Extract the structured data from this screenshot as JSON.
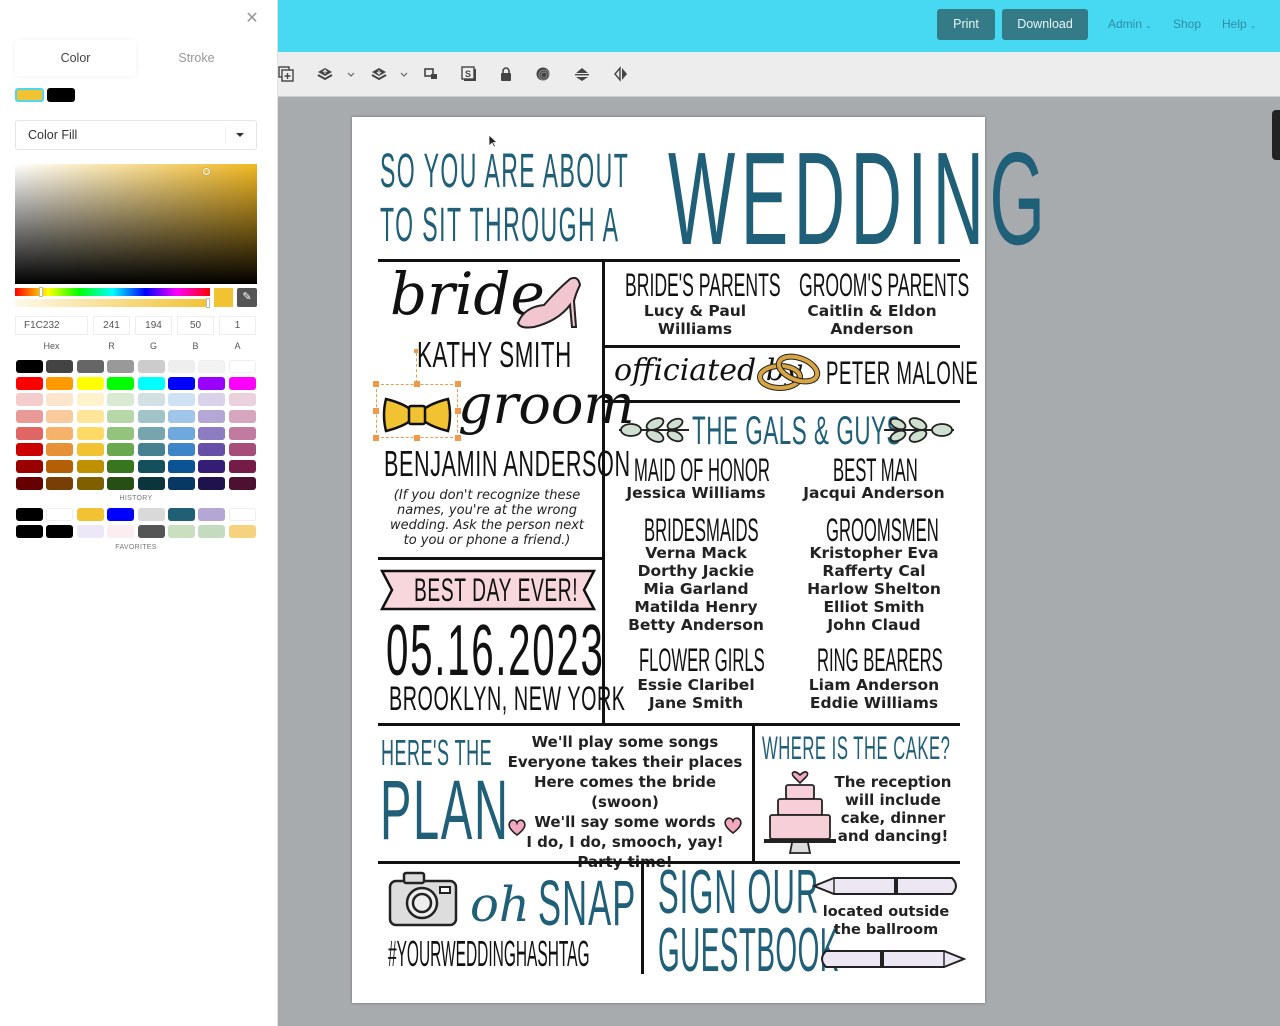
{
  "panel": {
    "close_icon": "close-icon",
    "tabs": [
      {
        "label": "Color",
        "active": true
      },
      {
        "label": "Stroke",
        "active": false
      }
    ],
    "selected_swatches": [
      "#F1C232",
      "#000000"
    ],
    "fill_mode": "Color Fill",
    "picker": {
      "hex": "F1C232",
      "r": "241",
      "g": "194",
      "b": "50",
      "a": "1",
      "labels": {
        "hex": "Hex",
        "r": "R",
        "g": "G",
        "b": "B",
        "a": "A"
      }
    },
    "palette": [
      "#000000",
      "#434343",
      "#666666",
      "#999999",
      "#cccccc",
      "#eeeeee",
      "#f3f3f3",
      "#ffffff",
      "#ff0000",
      "#ff9900",
      "#ffff00",
      "#00ff00",
      "#00ffff",
      "#0000ff",
      "#9900ff",
      "#ff00ff",
      "#f4cccc",
      "#fce5cd",
      "#fff2cc",
      "#d9ead3",
      "#d0e0e3",
      "#cfe2f3",
      "#d9d2e9",
      "#ead1dc",
      "#ea9999",
      "#f9cb9c",
      "#ffe599",
      "#b6d7a8",
      "#a2c4c9",
      "#9fc5e8",
      "#b4a7d6",
      "#d5a6bd",
      "#e06666",
      "#f6b26b",
      "#ffd966",
      "#93c47d",
      "#76a5af",
      "#6fa8dc",
      "#8e7cc3",
      "#c27ba0",
      "#cc0000",
      "#e69138",
      "#f1c232",
      "#6aa84f",
      "#45818e",
      "#3d85c6",
      "#674ea7",
      "#a64d79",
      "#990000",
      "#b45f06",
      "#bf9000",
      "#38761d",
      "#134f5c",
      "#0b5394",
      "#351c75",
      "#741b47",
      "#660000",
      "#783f04",
      "#7f6000",
      "#274e13",
      "#0c343d",
      "#073763",
      "#20124d",
      "#4c1130"
    ],
    "history_label": "HISTORY",
    "history": [
      "#000000",
      "#ffffff",
      "#f1c232",
      "#0000ff",
      "#d9d9d9",
      "#1f6077",
      "#b4a7d6",
      "#ffffff",
      "#000000",
      "#000000",
      "#ece8f8",
      "#fbeef0",
      "#555555",
      "#c9dfc0",
      "#c5dbbf",
      "#f5d27e"
    ],
    "favorites_label": "FAVORITES"
  },
  "topbar": {
    "print": "Print",
    "download": "Download",
    "nav": [
      {
        "label": "Admin",
        "dropdown": true
      },
      {
        "label": "Shop",
        "dropdown": false
      },
      {
        "label": "Help",
        "dropdown": true
      }
    ]
  },
  "toolbar": {
    "icons": [
      "duplicate-icon",
      "layer-up-icon",
      "layer-down-icon",
      "resize-icon",
      "s-badge-icon",
      "lock-icon",
      "opacity-icon",
      "align-icon",
      "flip-icon"
    ]
  },
  "poster": {
    "title_small_1": "SO YOU ARE ABOUT",
    "title_small_2": "TO SIT THROUGH A",
    "title_big": "WEDDING",
    "bride_script": "bride",
    "bride_name": "KATHY SMITH",
    "groom_script": "groom",
    "groom_name": "BENJAMIN ANDERSON",
    "disclaimer": "(If you don't recognize these names, you're at the wrong wedding. Ask the person next to you or phone a friend.)",
    "brides_parents_title": "BRIDE'S PARENTS",
    "brides_parents": [
      "Lucy & Paul",
      "Williams"
    ],
    "grooms_parents_title": "GROOM'S PARENTS",
    "grooms_parents": [
      "Caitlin & Eldon",
      "Anderson"
    ],
    "officiated_script": "officiated by",
    "officiant": "PETER MALONE",
    "party_title": "THE GALS & GUYS",
    "maid_title": "MAID OF HONOR",
    "maid": "Jessica Williams",
    "bestman_title": "BEST MAN",
    "bestman": "Jacqui Anderson",
    "bridesmaids_title": "BRIDESMAIDS",
    "bridesmaids": [
      "Verna Mack",
      "Dorthy Jackie",
      "Mia Garland",
      "Matilda Henry",
      "Betty Anderson"
    ],
    "groomsmen_title": "GROOMSMEN",
    "groomsmen": [
      "Kristopher Eva",
      "Rafferty Cal",
      "Harlow Shelton",
      "Elliot Smith",
      "John Claud"
    ],
    "flowergirls_title": "FLOWER GIRLS",
    "flowergirls": [
      "Essie Claribel",
      "Jane Smith"
    ],
    "ringbearers_title": "RING BEARERS",
    "ringbearers": [
      "Liam Anderson",
      "Eddie Williams"
    ],
    "banner": "BEST DAY EVER!",
    "date": "05.16.2023",
    "location": "BROOKLYN, NEW YORK",
    "plan_small": "HERE'S THE",
    "plan_big": "PLAN",
    "plan_lines": [
      "We'll play some songs",
      "Everyone takes their places",
      "Here comes the bride (swoon)",
      "We'll say some words",
      "I do, I do, smooch, yay!",
      "Party time!"
    ],
    "cake_title": "WHERE IS THE CAKE?",
    "cake_lines": [
      "The reception",
      "will include",
      "cake, dinner",
      "and dancing!"
    ],
    "snap_script": "oh",
    "snap": "SNAP",
    "hashtag": "#YOURWEDDINGHASHTAG",
    "guestbook_1": "SIGN OUR",
    "guestbook_2": "GUESTBOOK",
    "guestbook_note": [
      "located outside",
      "the ballroom"
    ]
  },
  "colors": {
    "accent_teal": "#205f78",
    "topbar": "#47d8f2",
    "button": "#347a87",
    "selection": "#f09a49",
    "fill": "#F1C232"
  }
}
